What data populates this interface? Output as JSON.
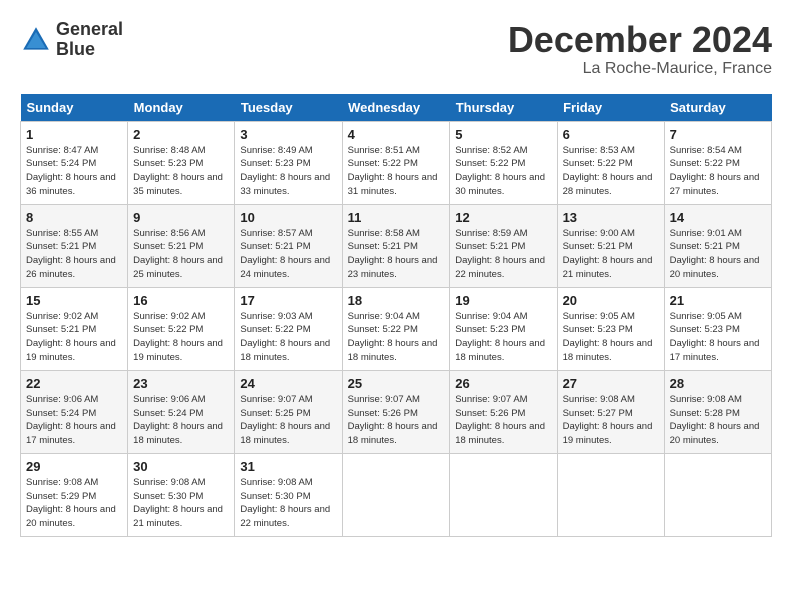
{
  "header": {
    "logo_line1": "General",
    "logo_line2": "Blue",
    "month_year": "December 2024",
    "location": "La Roche-Maurice, France"
  },
  "weekdays": [
    "Sunday",
    "Monday",
    "Tuesday",
    "Wednesday",
    "Thursday",
    "Friday",
    "Saturday"
  ],
  "weeks": [
    [
      {
        "day": "1",
        "sunrise": "8:47 AM",
        "sunset": "5:24 PM",
        "daylight": "8 hours and 36 minutes"
      },
      {
        "day": "2",
        "sunrise": "8:48 AM",
        "sunset": "5:23 PM",
        "daylight": "8 hours and 35 minutes"
      },
      {
        "day": "3",
        "sunrise": "8:49 AM",
        "sunset": "5:23 PM",
        "daylight": "8 hours and 33 minutes"
      },
      {
        "day": "4",
        "sunrise": "8:51 AM",
        "sunset": "5:22 PM",
        "daylight": "8 hours and 31 minutes"
      },
      {
        "day": "5",
        "sunrise": "8:52 AM",
        "sunset": "5:22 PM",
        "daylight": "8 hours and 30 minutes"
      },
      {
        "day": "6",
        "sunrise": "8:53 AM",
        "sunset": "5:22 PM",
        "daylight": "8 hours and 28 minutes"
      },
      {
        "day": "7",
        "sunrise": "8:54 AM",
        "sunset": "5:22 PM",
        "daylight": "8 hours and 27 minutes"
      }
    ],
    [
      {
        "day": "8",
        "sunrise": "8:55 AM",
        "sunset": "5:21 PM",
        "daylight": "8 hours and 26 minutes"
      },
      {
        "day": "9",
        "sunrise": "8:56 AM",
        "sunset": "5:21 PM",
        "daylight": "8 hours and 25 minutes"
      },
      {
        "day": "10",
        "sunrise": "8:57 AM",
        "sunset": "5:21 PM",
        "daylight": "8 hours and 24 minutes"
      },
      {
        "day": "11",
        "sunrise": "8:58 AM",
        "sunset": "5:21 PM",
        "daylight": "8 hours and 23 minutes"
      },
      {
        "day": "12",
        "sunrise": "8:59 AM",
        "sunset": "5:21 PM",
        "daylight": "8 hours and 22 minutes"
      },
      {
        "day": "13",
        "sunrise": "9:00 AM",
        "sunset": "5:21 PM",
        "daylight": "8 hours and 21 minutes"
      },
      {
        "day": "14",
        "sunrise": "9:01 AM",
        "sunset": "5:21 PM",
        "daylight": "8 hours and 20 minutes"
      }
    ],
    [
      {
        "day": "15",
        "sunrise": "9:02 AM",
        "sunset": "5:21 PM",
        "daylight": "8 hours and 19 minutes"
      },
      {
        "day": "16",
        "sunrise": "9:02 AM",
        "sunset": "5:22 PM",
        "daylight": "8 hours and 19 minutes"
      },
      {
        "day": "17",
        "sunrise": "9:03 AM",
        "sunset": "5:22 PM",
        "daylight": "8 hours and 18 minutes"
      },
      {
        "day": "18",
        "sunrise": "9:04 AM",
        "sunset": "5:22 PM",
        "daylight": "8 hours and 18 minutes"
      },
      {
        "day": "19",
        "sunrise": "9:04 AM",
        "sunset": "5:23 PM",
        "daylight": "8 hours and 18 minutes"
      },
      {
        "day": "20",
        "sunrise": "9:05 AM",
        "sunset": "5:23 PM",
        "daylight": "8 hours and 18 minutes"
      },
      {
        "day": "21",
        "sunrise": "9:05 AM",
        "sunset": "5:23 PM",
        "daylight": "8 hours and 17 minutes"
      }
    ],
    [
      {
        "day": "22",
        "sunrise": "9:06 AM",
        "sunset": "5:24 PM",
        "daylight": "8 hours and 17 minutes"
      },
      {
        "day": "23",
        "sunrise": "9:06 AM",
        "sunset": "5:24 PM",
        "daylight": "8 hours and 18 minutes"
      },
      {
        "day": "24",
        "sunrise": "9:07 AM",
        "sunset": "5:25 PM",
        "daylight": "8 hours and 18 minutes"
      },
      {
        "day": "25",
        "sunrise": "9:07 AM",
        "sunset": "5:26 PM",
        "daylight": "8 hours and 18 minutes"
      },
      {
        "day": "26",
        "sunrise": "9:07 AM",
        "sunset": "5:26 PM",
        "daylight": "8 hours and 18 minutes"
      },
      {
        "day": "27",
        "sunrise": "9:08 AM",
        "sunset": "5:27 PM",
        "daylight": "8 hours and 19 minutes"
      },
      {
        "day": "28",
        "sunrise": "9:08 AM",
        "sunset": "5:28 PM",
        "daylight": "8 hours and 20 minutes"
      }
    ],
    [
      {
        "day": "29",
        "sunrise": "9:08 AM",
        "sunset": "5:29 PM",
        "daylight": "8 hours and 20 minutes"
      },
      {
        "day": "30",
        "sunrise": "9:08 AM",
        "sunset": "5:30 PM",
        "daylight": "8 hours and 21 minutes"
      },
      {
        "day": "31",
        "sunrise": "9:08 AM",
        "sunset": "5:30 PM",
        "daylight": "8 hours and 22 minutes"
      },
      null,
      null,
      null,
      null
    ]
  ]
}
